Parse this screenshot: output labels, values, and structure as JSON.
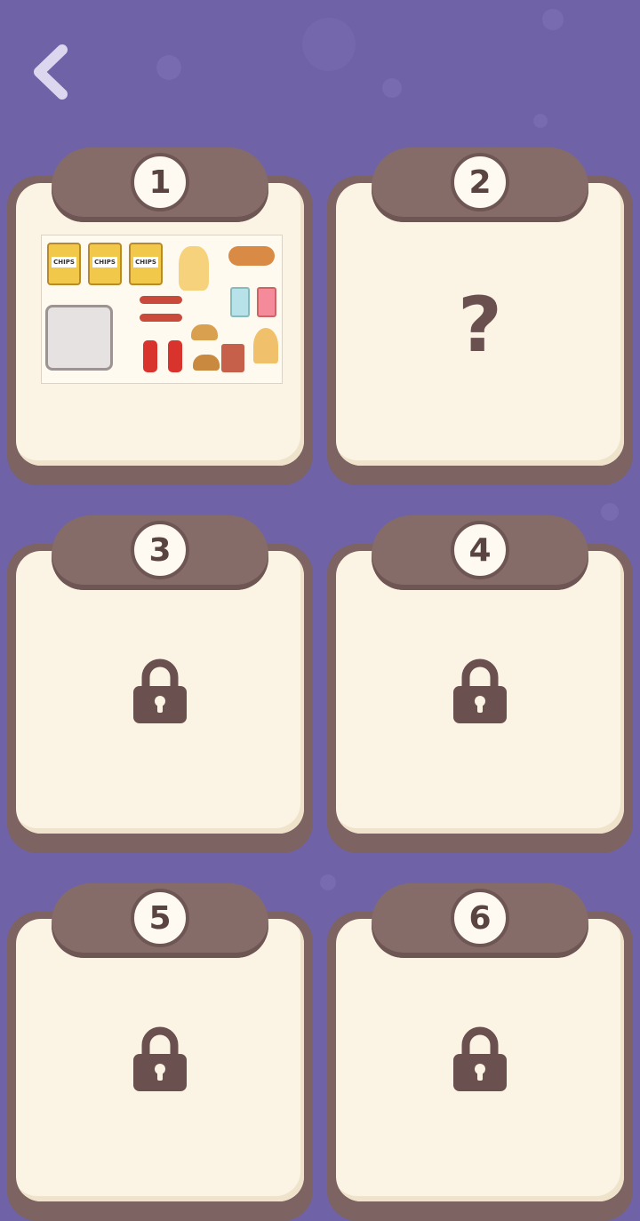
{
  "screen": {
    "background_color": "#6f62a7",
    "back_button": {
      "icon": "chevron-left-icon",
      "color": "#dcd6ee"
    }
  },
  "levels": [
    {
      "number": "1",
      "state": "unlocked",
      "preview": {
        "chip_label": "CHIPS"
      }
    },
    {
      "number": "2",
      "state": "unknown",
      "symbol": "?"
    },
    {
      "number": "3",
      "state": "locked",
      "icon": "lock-icon"
    },
    {
      "number": "4",
      "state": "locked",
      "icon": "lock-icon"
    },
    {
      "number": "5",
      "state": "locked",
      "icon": "lock-icon"
    },
    {
      "number": "6",
      "state": "locked",
      "icon": "lock-icon"
    }
  ],
  "colors": {
    "card_frame": "#7d6361",
    "card_paper": "#fbf3e3",
    "clip": "#866c69",
    "lock": "#6a5150"
  }
}
